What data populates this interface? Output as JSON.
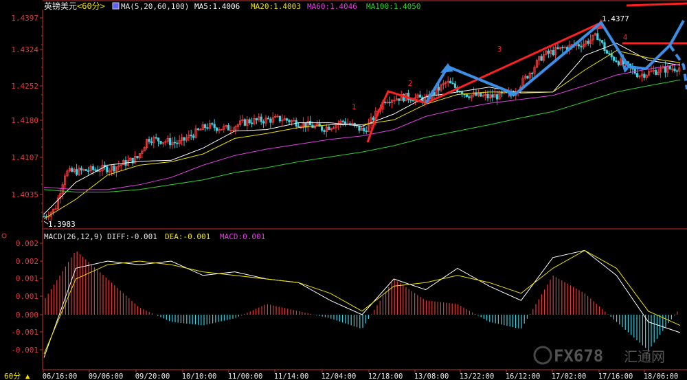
{
  "header": {
    "symbol": "英镑美元",
    "period": "<60分>",
    "ma_spec": "MA(5,20,60,100)",
    "ma5": "MA5:1.4006",
    "ma20": "MA20:1.4003",
    "ma60": "MA60:1.4046",
    "ma100": "MA100:1.4050"
  },
  "macd_header": {
    "spec": "MACD(26,12,9)",
    "diff": "DIFF:-0.001",
    "dea": "DEA:-0.001",
    "macd": "MACD:0.001"
  },
  "bottom_bar": {
    "period_button": "60分"
  },
  "watermark": {
    "text": "FX678",
    "suffix": "汇通网"
  },
  "colors": {
    "up": "#ff3b3b",
    "down": "#3fd0e0",
    "ma5": "#ffffff",
    "ma20": "#f2e400",
    "ma60": "#e040e0",
    "ma100": "#30d030",
    "axis": "#c83232",
    "annotation_red": "#ff2020",
    "annotation_blue": "#3b8fe6"
  },
  "chart_data": [
    {
      "type": "candlestick",
      "y_ticks": [
        "1.4397",
        "1.4324",
        "1.4252",
        "1.4180",
        "1.4107",
        "1.4035"
      ],
      "ylim": [
        1.3975,
        1.4405
      ],
      "x_ticks": [
        "06/16:00",
        "09/06:00",
        "09/20:00",
        "10/10:00",
        "11/00:00",
        "11/14:00",
        "12/04:00",
        "12/18:00",
        "13/08:00",
        "13/22:00",
        "16/12:00",
        "17/02:00",
        "17/16:00",
        "18/06:00"
      ],
      "price_labels": {
        "high": "1.4377",
        "low": "1.3983"
      },
      "wave_labels": [
        "1",
        "2",
        "3",
        "4"
      ],
      "series": [
        {
          "name": "MA5",
          "values": [
            1.3995,
            1.406,
            1.4095,
            1.4103,
            1.4105,
            1.413,
            1.4165,
            1.4168,
            1.4182,
            1.4182,
            1.4175,
            1.42,
            1.4235,
            1.4245,
            1.4255,
            1.4243,
            1.4245,
            1.432,
            1.4345,
            1.431,
            1.43
          ]
        },
        {
          "name": "MA20",
          "values": [
            1.3985,
            1.4025,
            1.4075,
            1.4095,
            1.4102,
            1.4118,
            1.415,
            1.416,
            1.4172,
            1.4178,
            1.4178,
            1.4188,
            1.422,
            1.424,
            1.4245,
            1.4245,
            1.4245,
            1.429,
            1.433,
            1.4315,
            1.4305
          ]
        },
        {
          "name": "MA60",
          "values": [
            1.405,
            1.4045,
            1.4045,
            1.4055,
            1.407,
            1.4095,
            1.4115,
            1.4128,
            1.4138,
            1.4148,
            1.4155,
            1.4168,
            1.4195,
            1.421,
            1.4222,
            1.423,
            1.4238,
            1.4258,
            1.428,
            1.4292,
            1.4302
          ]
        },
        {
          "name": "MA100",
          "values": [
            1.4045,
            1.404,
            1.404,
            1.4045,
            1.4055,
            1.4065,
            1.408,
            1.409,
            1.4102,
            1.4112,
            1.4122,
            1.4135,
            1.4152,
            1.4165,
            1.4178,
            1.4192,
            1.4205,
            1.4225,
            1.4245,
            1.4258,
            1.427
          ]
        }
      ]
    },
    {
      "type": "bar",
      "title": "MACD(26,12,9)",
      "y_ticks": [
        "0.002",
        "0.002",
        "0.001",
        "0.001",
        "0.000",
        "-0.001",
        "-0.001"
      ],
      "ylim": [
        -0.0013,
        0.0021
      ],
      "series": [
        {
          "name": "DIFF",
          "values": [
            -0.0012,
            0.0013,
            0.0015,
            0.0014,
            0.0015,
            0.0011,
            0.0012,
            0.001,
            0.0009,
            0.0004,
            0.0,
            0.001,
            0.0007,
            0.0013,
            0.0008,
            0.0004,
            0.0016,
            0.0018,
            0.0011,
            -0.0002,
            -0.0005
          ]
        },
        {
          "name": "DEA",
          "values": [
            -0.0011,
            0.001,
            0.0014,
            0.0015,
            0.0014,
            0.0012,
            0.0011,
            0.001,
            0.0009,
            0.0006,
            0.0001,
            0.0008,
            0.0009,
            0.0011,
            0.0009,
            0.0006,
            0.0013,
            0.0018,
            0.0013,
            0.0001,
            -0.0003
          ]
        },
        {
          "name": "MACD",
          "values": [
            0.0004,
            0.0018,
            0.001,
            0.0002,
            -0.0002,
            -0.0003,
            -0.0001,
            0.0003,
            0.0001,
            -0.0001,
            -0.0004,
            0.001,
            0.0004,
            0.0003,
            -0.0002,
            -0.0004,
            0.0011,
            0.0006,
            -0.0002,
            -0.001,
            0.0002
          ]
        }
      ]
    }
  ]
}
